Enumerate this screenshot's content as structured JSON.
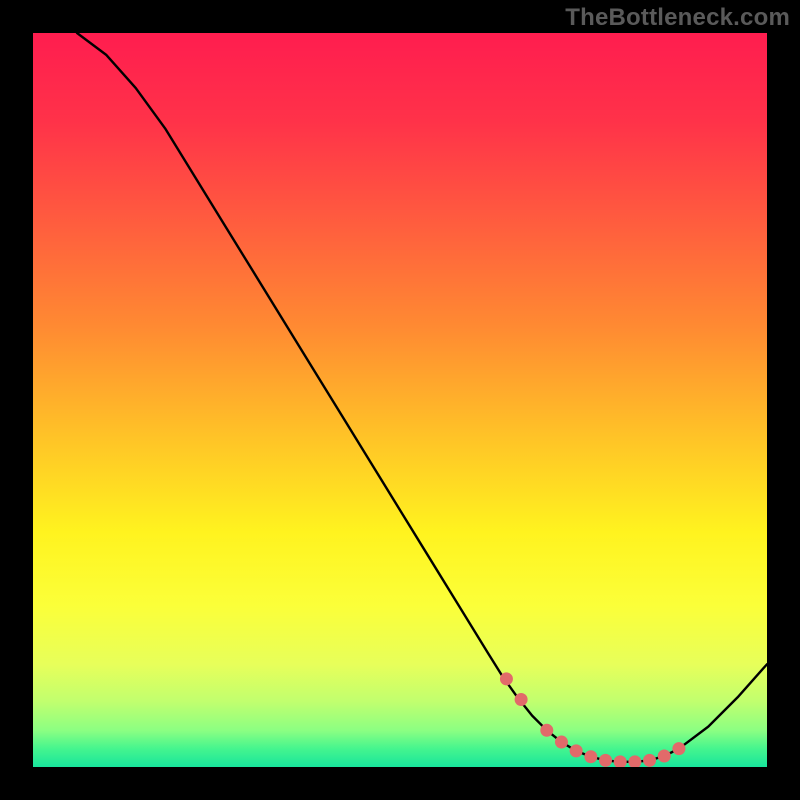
{
  "attribution": "TheBottleneck.com",
  "chart_data": {
    "type": "line",
    "title": "",
    "xlabel": "",
    "ylabel": "",
    "xlim": [
      0,
      100
    ],
    "ylim": [
      0,
      100
    ],
    "series": [
      {
        "name": "bottleneck-curve",
        "x": [
          6,
          10,
          14,
          18,
          22,
          26,
          30,
          34,
          38,
          42,
          46,
          50,
          54,
          58,
          62,
          64,
          66,
          68,
          70,
          72,
          74,
          76,
          78,
          80,
          82,
          84,
          86,
          88,
          92,
          96,
          100
        ],
        "y": [
          100,
          97,
          92.5,
          87,
          80.5,
          74,
          67.5,
          61,
          54.5,
          48,
          41.5,
          35,
          28.5,
          22,
          15.5,
          12.3,
          9.5,
          7,
          5,
          3.4,
          2.2,
          1.4,
          0.9,
          0.7,
          0.7,
          0.9,
          1.5,
          2.5,
          5.5,
          9.5,
          14
        ]
      }
    ],
    "markers": {
      "name": "highlighted-points",
      "color": "#e26a6a",
      "x": [
        64.5,
        66.5,
        70,
        72,
        74,
        76,
        78,
        80,
        82,
        84,
        86,
        88
      ],
      "y": [
        12.0,
        9.2,
        5.0,
        3.4,
        2.2,
        1.4,
        0.9,
        0.7,
        0.7,
        0.9,
        1.5,
        2.5
      ]
    },
    "background_gradient": {
      "stops": [
        {
          "offset": 0.0,
          "color": "#ff1d4f"
        },
        {
          "offset": 0.12,
          "color": "#ff3249"
        },
        {
          "offset": 0.25,
          "color": "#ff5a3f"
        },
        {
          "offset": 0.4,
          "color": "#ff8a32"
        },
        {
          "offset": 0.55,
          "color": "#ffc327"
        },
        {
          "offset": 0.68,
          "color": "#fff31f"
        },
        {
          "offset": 0.78,
          "color": "#fbff39"
        },
        {
          "offset": 0.86,
          "color": "#e7ff5a"
        },
        {
          "offset": 0.91,
          "color": "#c2ff6e"
        },
        {
          "offset": 0.95,
          "color": "#8cff82"
        },
        {
          "offset": 0.975,
          "color": "#45f58e"
        },
        {
          "offset": 1.0,
          "color": "#18e59c"
        }
      ]
    }
  }
}
